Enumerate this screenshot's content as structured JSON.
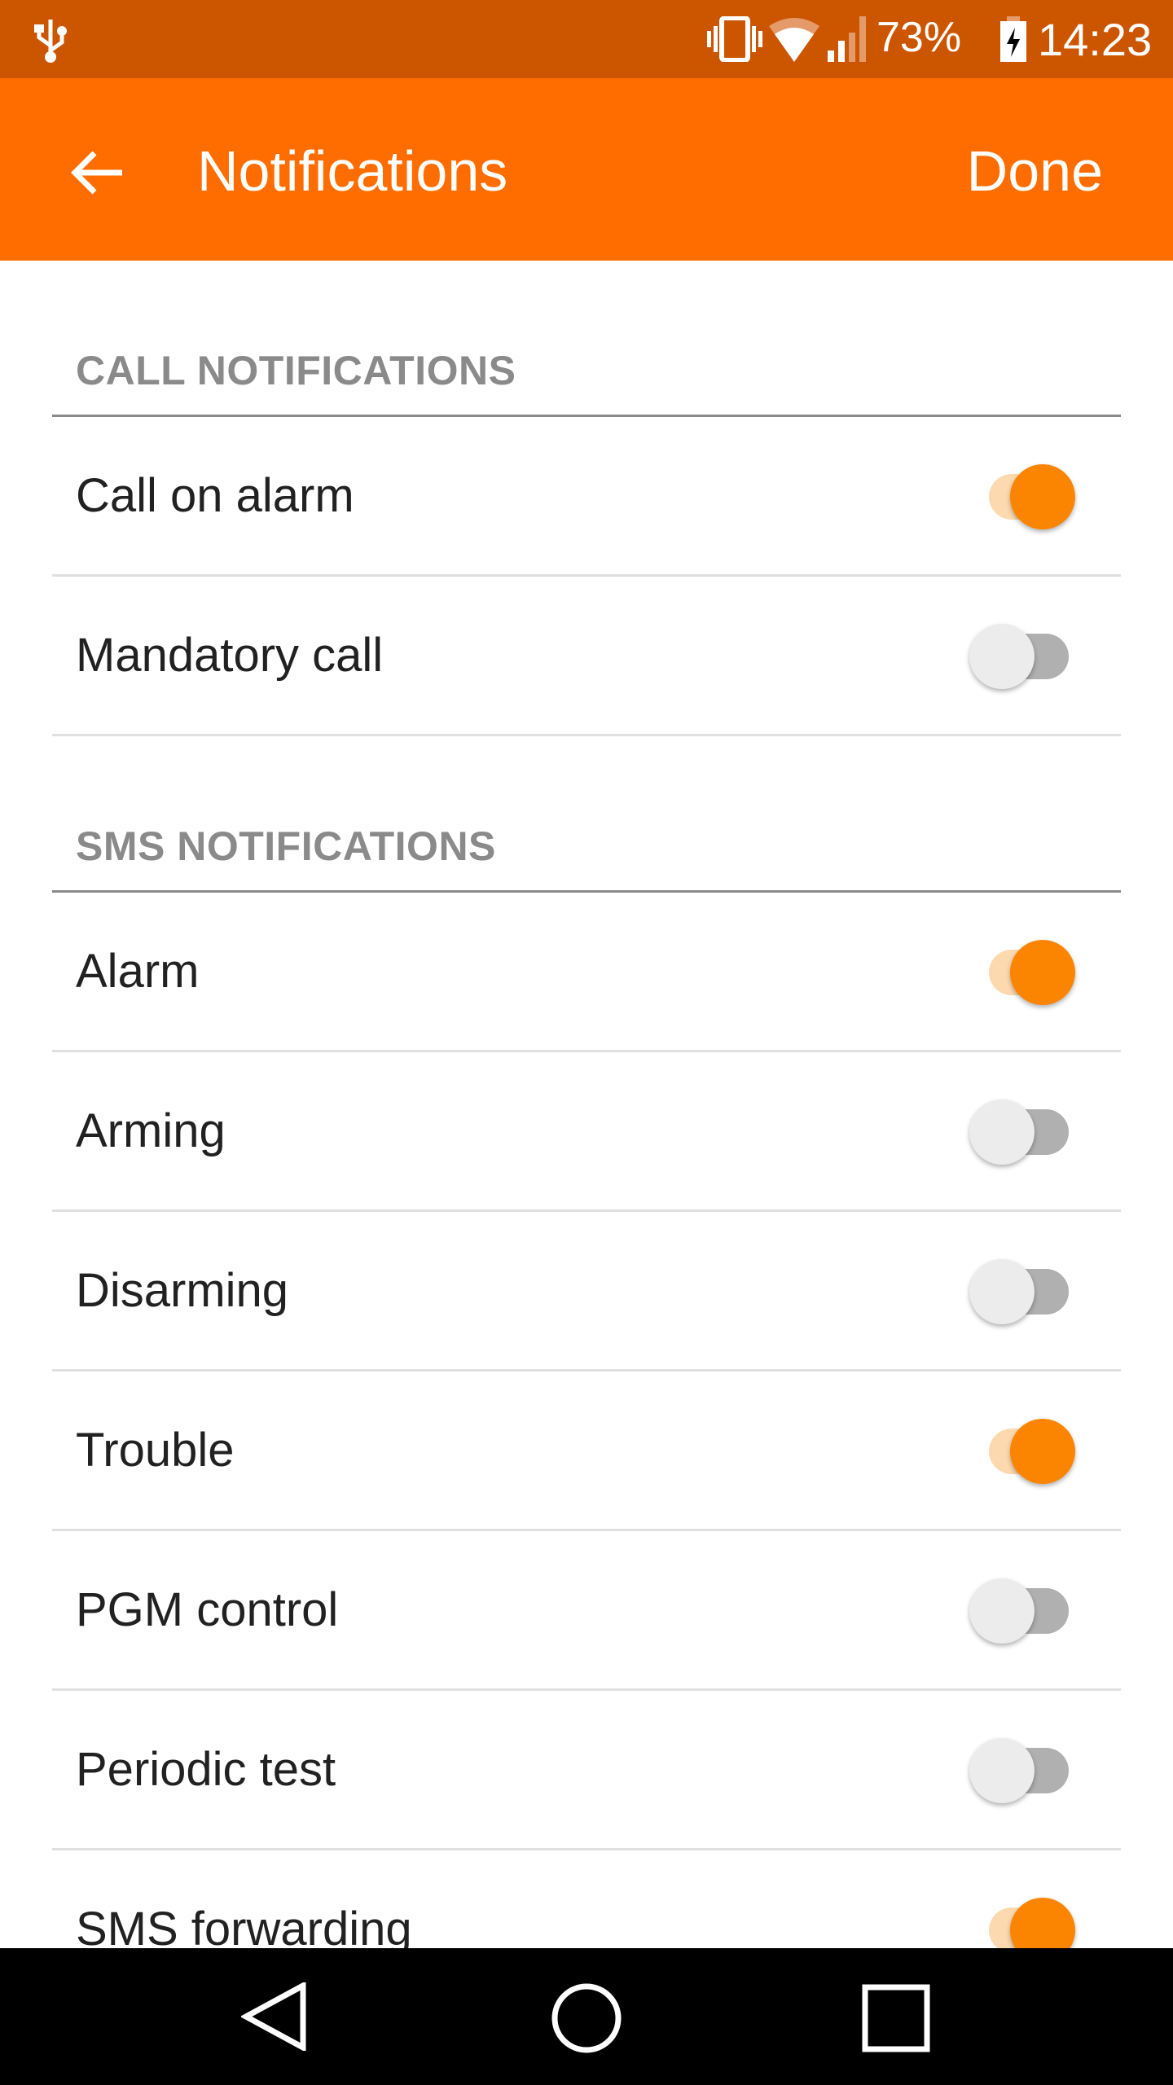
{
  "status_bar": {
    "battery": "73%",
    "time": "14:23",
    "icons": [
      "usb-icon",
      "vibrate-icon",
      "wifi-icon",
      "signal-icon",
      "battery-charging-icon"
    ]
  },
  "app_bar": {
    "title": "Notifications",
    "done_label": "Done",
    "back_icon": "arrow-left-icon"
  },
  "colors": {
    "accent": "#fb8500",
    "app_bar": "#ff6d00",
    "status_bar": "#cc5500"
  },
  "sections": [
    {
      "title": "CALL NOTIFICATIONS",
      "items": [
        {
          "label": "Call on alarm",
          "on": true
        },
        {
          "label": "Mandatory call",
          "on": false
        }
      ]
    },
    {
      "title": "SMS NOTIFICATIONS",
      "items": [
        {
          "label": "Alarm",
          "on": true
        },
        {
          "label": "Arming",
          "on": false
        },
        {
          "label": "Disarming",
          "on": false
        },
        {
          "label": "Trouble",
          "on": true
        },
        {
          "label": "PGM control",
          "on": false
        },
        {
          "label": "Periodic test",
          "on": false
        },
        {
          "label": "SMS forwarding",
          "on": true
        }
      ]
    }
  ],
  "nav_bar": {
    "icons": [
      "back-icon",
      "home-icon",
      "recents-icon"
    ]
  }
}
